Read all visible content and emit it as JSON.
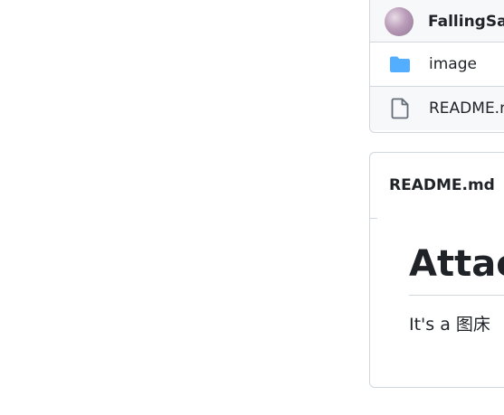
{
  "file_browser": {
    "commit_author": "FallingSak",
    "items": [
      {
        "name": "image",
        "icon": "folder-icon",
        "type": "directory"
      },
      {
        "name": "README.md",
        "icon": "file-icon",
        "type": "file"
      }
    ]
  },
  "readme": {
    "header_title": "README.md",
    "heading": "Attac",
    "body_text": "It's a 图床"
  },
  "colors": {
    "border": "#d0d7de",
    "row_bg": "#f6f8fa",
    "folder": "#54aeff",
    "text": "#1f2328"
  }
}
